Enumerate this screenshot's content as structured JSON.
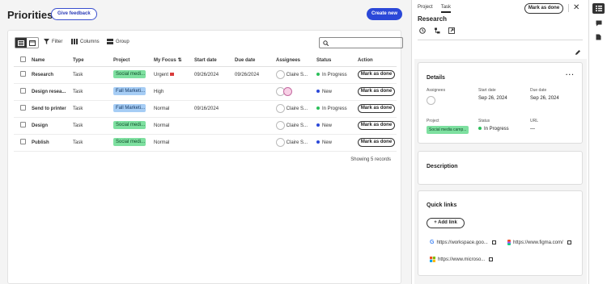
{
  "header": {
    "title": "Priorities",
    "feedback_label": "Give feedback",
    "create_label": "Create new"
  },
  "toolbar": {
    "filter_label": "Filter",
    "columns_label": "Columns",
    "group_label": "Group",
    "search_placeholder": ""
  },
  "table": {
    "headers": [
      "Name",
      "Type",
      "Project",
      "My Focus",
      "Start date",
      "Due date",
      "Assignees",
      "Status",
      "Action"
    ],
    "rows": [
      {
        "name": "Research",
        "type": "Task",
        "project": "Social medi...",
        "project_color": "green",
        "focus": "Urgent",
        "flag": true,
        "start": "09/26/2024",
        "due": "09/26/2024",
        "assignee": "Claire S...",
        "assignee_pink": false,
        "status": "In Progress",
        "status_color": "#2bbf5a",
        "action": "Mark as done"
      },
      {
        "name": "Design resea...",
        "type": "Task",
        "project": "Fall Marketi...",
        "project_color": "blue",
        "focus": "High",
        "flag": false,
        "start": "",
        "due": "",
        "assignee": "",
        "assignee_pink": true,
        "status": "New",
        "status_color": "#2b48d8",
        "action": "Mark as done"
      },
      {
        "name": "Send to printer",
        "type": "Task",
        "project": "Fall Marketi...",
        "project_color": "blue",
        "focus": "Normal",
        "flag": false,
        "start": "09/16/2024",
        "due": "",
        "assignee": "Claire S...",
        "assignee_pink": false,
        "status": "In Progress",
        "status_color": "#2bbf5a",
        "action": "Mark as done"
      },
      {
        "name": "Design",
        "type": "Task",
        "project": "Social medi...",
        "project_color": "green",
        "focus": "Normal",
        "flag": false,
        "start": "",
        "due": "",
        "assignee": "Claire S...",
        "assignee_pink": false,
        "status": "New",
        "status_color": "#2b48d8",
        "action": "Mark as done"
      },
      {
        "name": "Publish",
        "type": "Task",
        "project": "Social medi...",
        "project_color": "green",
        "focus": "Normal",
        "flag": false,
        "start": "",
        "due": "",
        "assignee": "Claire S...",
        "assignee_pink": false,
        "status": "New",
        "status_color": "#2b48d8",
        "action": "Mark as done"
      }
    ],
    "footer": "Showing 5 records"
  },
  "panel": {
    "tabs": [
      "Project",
      "Task"
    ],
    "mark_done_label": "Mark as done",
    "title": "Research",
    "details": {
      "title": "Details",
      "assignees_label": "Assignees",
      "start_label": "Start date",
      "start_value": "Sep 26, 2024",
      "due_label": "Due date",
      "due_value": "Sep 26, 2024",
      "project_label": "Project",
      "project_value": "Social media camp...",
      "status_label": "Status",
      "status_value": "In Progress",
      "url_label": "URL",
      "url_value": "—"
    },
    "description_title": "Description",
    "quick_links": {
      "title": "Quick links",
      "add_label": "+ Add link",
      "links": [
        "https://workspace.goo...",
        "https://www.figma.com/",
        "https://www.microso..."
      ]
    }
  }
}
